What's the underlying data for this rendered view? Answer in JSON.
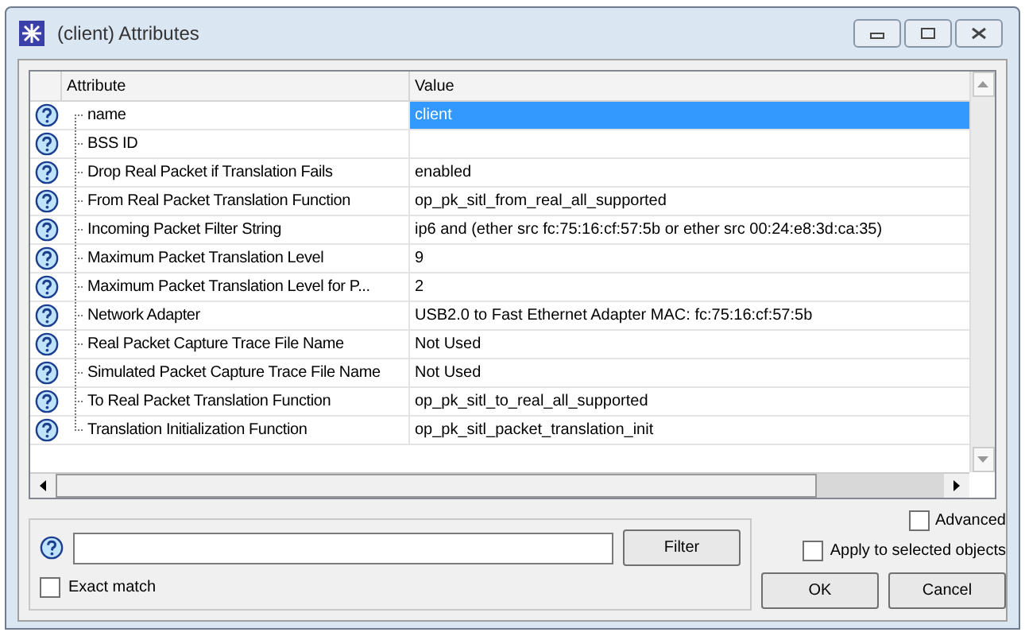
{
  "window": {
    "title": "(client) Attributes"
  },
  "table": {
    "columns": [
      "Attribute",
      "Value"
    ],
    "rows": [
      {
        "attribute": "name",
        "value": "client",
        "selected": true
      },
      {
        "attribute": "BSS ID",
        "value": "",
        "selected": false
      },
      {
        "attribute": "Drop Real Packet if Translation Fails",
        "value": "enabled",
        "selected": false
      },
      {
        "attribute": "From Real Packet Translation Function",
        "value": "op_pk_sitl_from_real_all_supported",
        "selected": false
      },
      {
        "attribute": "Incoming Packet Filter String",
        "value": "ip6 and (ether src fc:75:16:cf:57:5b or ether src 00:24:e8:3d:ca:35)",
        "selected": false
      },
      {
        "attribute": "Maximum Packet Translation Level",
        "value": "9",
        "selected": false
      },
      {
        "attribute": "Maximum Packet Translation Level for P...",
        "value": "2",
        "selected": false
      },
      {
        "attribute": "Network Adapter",
        "value": "USB2.0 to Fast Ethernet Adapter MAC: fc:75:16:cf:57:5b",
        "selected": false
      },
      {
        "attribute": "Real Packet Capture Trace File Name",
        "value": "Not Used",
        "selected": false
      },
      {
        "attribute": "Simulated Packet Capture Trace File Name",
        "value": "Not Used",
        "selected": false
      },
      {
        "attribute": "To Real Packet Translation Function",
        "value": "op_pk_sitl_to_real_all_supported",
        "selected": false
      },
      {
        "attribute": "Translation Initialization Function",
        "value": "op_pk_sitl_packet_translation_init",
        "selected": false
      }
    ]
  },
  "filter": {
    "button": "Filter",
    "exact_match": {
      "label": "Exact match",
      "checked": false
    }
  },
  "options": [
    {
      "label": "Advanced",
      "checked": false
    },
    {
      "label": "Apply to selected objects",
      "checked": false
    }
  ],
  "buttons": [
    "OK",
    "Cancel"
  ]
}
